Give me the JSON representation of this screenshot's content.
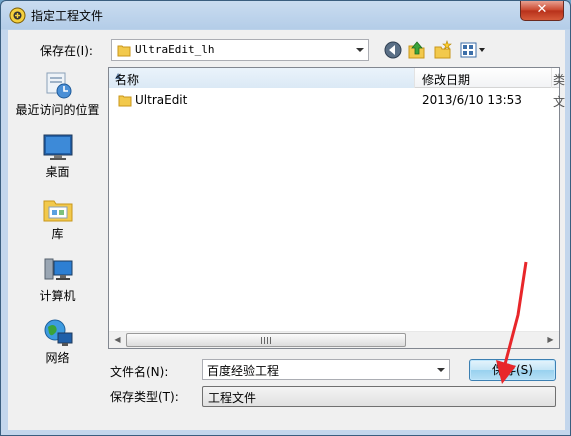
{
  "window": {
    "title": "指定工程文件",
    "close_label": "✕"
  },
  "top": {
    "save_in_label": "保存在(I):",
    "location": "UltraEdit_lh"
  },
  "places": [
    {
      "label": "最近访问的位置",
      "icon": "recent-places-icon"
    },
    {
      "label": "桌面",
      "icon": "desktop-icon"
    },
    {
      "label": "库",
      "icon": "libraries-icon"
    },
    {
      "label": "计算机",
      "icon": "computer-icon"
    },
    {
      "label": "网络",
      "icon": "network-icon"
    }
  ],
  "filelist": {
    "columns": {
      "name": "名称",
      "date": "修改日期",
      "more": "类"
    },
    "rows": [
      {
        "name": "UltraEdit",
        "date": "2013/6/10 13:53",
        "more": "文"
      }
    ]
  },
  "bottom": {
    "filename_label": "文件名(N):",
    "filename_value": "百度经验工程",
    "filetype_label": "保存类型(T):",
    "filetype_value": "工程文件",
    "save_button": "保存(S)"
  }
}
